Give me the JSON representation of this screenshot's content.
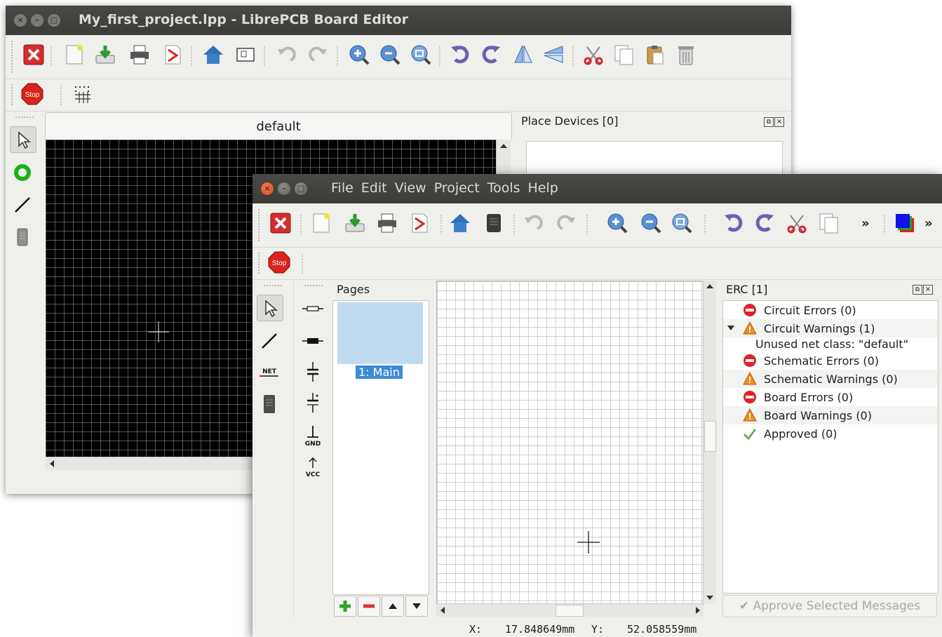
{
  "board_window": {
    "title": "My_first_project.lpp - LibrePCB Board Editor",
    "tab_label": "default",
    "place_devices_title": "Place Devices [0]",
    "toolbar_icons": [
      "close-project-icon",
      "new-icon",
      "save-icon",
      "print-icon",
      "export-pdf-icon",
      "home-icon",
      "layer-icon",
      "undo-icon",
      "redo-icon",
      "zoom-in-icon",
      "zoom-out-icon",
      "zoom-all-icon",
      "rotate-ccw-icon",
      "rotate-cw-icon",
      "flip-h-icon",
      "flip-v-icon",
      "cut-icon",
      "copy-icon",
      "paste-icon",
      "delete-icon"
    ],
    "toolbar2_icons": [
      "stop-icon",
      "grid-icon"
    ],
    "left_tools": [
      "select-icon",
      "via-icon",
      "trace-icon",
      "device-icon"
    ]
  },
  "schematic_window": {
    "menu": [
      "File",
      "Edit",
      "View",
      "Project",
      "Tools",
      "Help"
    ],
    "overflow_label": "»",
    "stop_label": "Stop",
    "net_label": "NET",
    "gnd_label": "GND",
    "vcc_label": "VCC",
    "pages_title": "Pages",
    "pages": [
      {
        "label": "1: Main"
      }
    ],
    "erc_title": "ERC [1]",
    "erc_items": [
      {
        "icon": "error-icon",
        "label": "Circuit Errors (0)"
      },
      {
        "icon": "warning-icon",
        "label": "Circuit Warnings (1)",
        "expanded": true
      },
      {
        "icon": "",
        "label": "Unused net class: \"default\""
      },
      {
        "icon": "error-icon",
        "label": "Schematic Errors (0)"
      },
      {
        "icon": "warning-icon",
        "label": "Schematic Warnings (0)"
      },
      {
        "icon": "error-icon",
        "label": "Board Errors (0)"
      },
      {
        "icon": "warning-icon",
        "label": "Board Warnings (0)"
      },
      {
        "icon": "check-icon",
        "label": "Approved (0)"
      }
    ],
    "approve_button": "✔ Approve Selected Messages",
    "status": {
      "x_label": "X:",
      "x_value": "17.848649mm",
      "y_label": "Y:",
      "y_value": "52.058559mm"
    }
  },
  "colors": {
    "title_bar": "#3c3b37",
    "window_bg": "#efefec",
    "board_bg": "#000000",
    "selection": "#3d8ad6",
    "page_thumb": "#c0dbee",
    "error": "#e0202a",
    "warning": "#f28c1a"
  }
}
